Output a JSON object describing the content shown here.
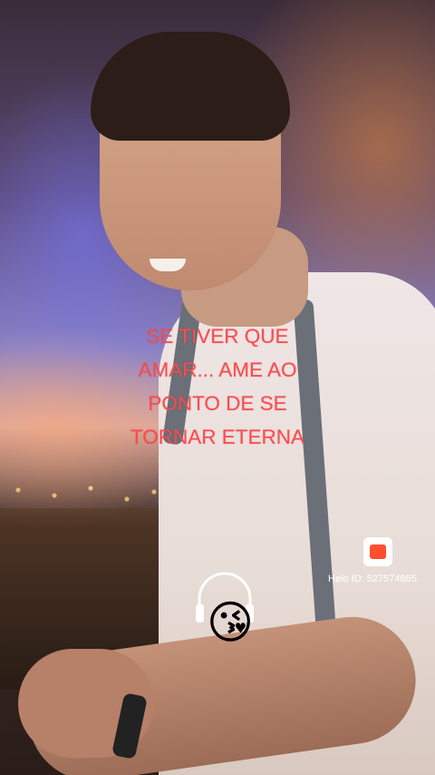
{
  "caption": {
    "lines": [
      "SE TIVER QUE",
      "AMAR... AME AO",
      "PONTO DE SE",
      "TORNAR ETERNA"
    ],
    "color": "#ff4b4f"
  },
  "watermark": {
    "app_icon": "helo-app-icon",
    "id_text": "Helo ID: 527574865"
  },
  "sticker": {
    "icon": "headphones-icon",
    "emoji": "😘"
  }
}
